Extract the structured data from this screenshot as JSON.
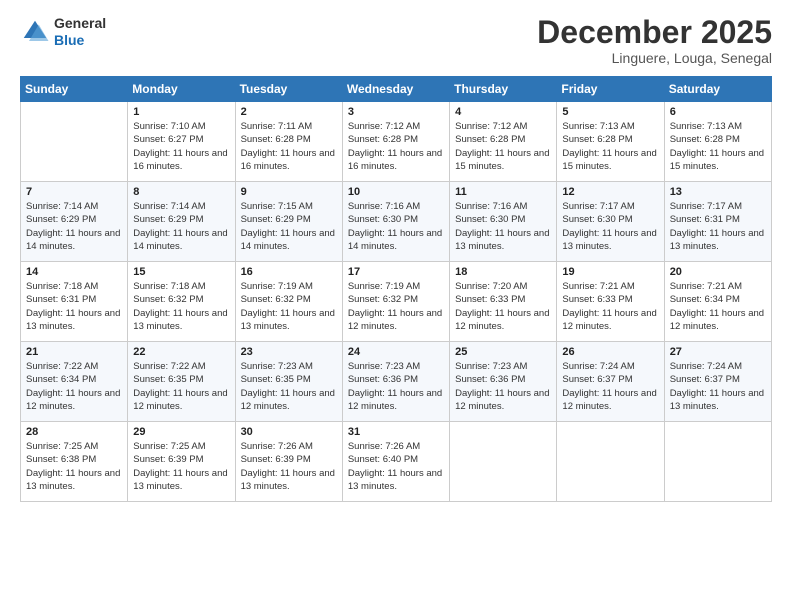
{
  "logo": {
    "general": "General",
    "blue": "Blue"
  },
  "header": {
    "month": "December 2025",
    "location": "Linguere, Louga, Senegal"
  },
  "weekdays": [
    "Sunday",
    "Monday",
    "Tuesday",
    "Wednesday",
    "Thursday",
    "Friday",
    "Saturday"
  ],
  "weeks": [
    [
      {
        "day": "",
        "sunrise": "",
        "sunset": "",
        "daylight": ""
      },
      {
        "day": "1",
        "sunrise": "Sunrise: 7:10 AM",
        "sunset": "Sunset: 6:27 PM",
        "daylight": "Daylight: 11 hours and 16 minutes."
      },
      {
        "day": "2",
        "sunrise": "Sunrise: 7:11 AM",
        "sunset": "Sunset: 6:28 PM",
        "daylight": "Daylight: 11 hours and 16 minutes."
      },
      {
        "day": "3",
        "sunrise": "Sunrise: 7:12 AM",
        "sunset": "Sunset: 6:28 PM",
        "daylight": "Daylight: 11 hours and 16 minutes."
      },
      {
        "day": "4",
        "sunrise": "Sunrise: 7:12 AM",
        "sunset": "Sunset: 6:28 PM",
        "daylight": "Daylight: 11 hours and 15 minutes."
      },
      {
        "day": "5",
        "sunrise": "Sunrise: 7:13 AM",
        "sunset": "Sunset: 6:28 PM",
        "daylight": "Daylight: 11 hours and 15 minutes."
      },
      {
        "day": "6",
        "sunrise": "Sunrise: 7:13 AM",
        "sunset": "Sunset: 6:28 PM",
        "daylight": "Daylight: 11 hours and 15 minutes."
      }
    ],
    [
      {
        "day": "7",
        "sunrise": "Sunrise: 7:14 AM",
        "sunset": "Sunset: 6:29 PM",
        "daylight": "Daylight: 11 hours and 14 minutes."
      },
      {
        "day": "8",
        "sunrise": "Sunrise: 7:14 AM",
        "sunset": "Sunset: 6:29 PM",
        "daylight": "Daylight: 11 hours and 14 minutes."
      },
      {
        "day": "9",
        "sunrise": "Sunrise: 7:15 AM",
        "sunset": "Sunset: 6:29 PM",
        "daylight": "Daylight: 11 hours and 14 minutes."
      },
      {
        "day": "10",
        "sunrise": "Sunrise: 7:16 AM",
        "sunset": "Sunset: 6:30 PM",
        "daylight": "Daylight: 11 hours and 14 minutes."
      },
      {
        "day": "11",
        "sunrise": "Sunrise: 7:16 AM",
        "sunset": "Sunset: 6:30 PM",
        "daylight": "Daylight: 11 hours and 13 minutes."
      },
      {
        "day": "12",
        "sunrise": "Sunrise: 7:17 AM",
        "sunset": "Sunset: 6:30 PM",
        "daylight": "Daylight: 11 hours and 13 minutes."
      },
      {
        "day": "13",
        "sunrise": "Sunrise: 7:17 AM",
        "sunset": "Sunset: 6:31 PM",
        "daylight": "Daylight: 11 hours and 13 minutes."
      }
    ],
    [
      {
        "day": "14",
        "sunrise": "Sunrise: 7:18 AM",
        "sunset": "Sunset: 6:31 PM",
        "daylight": "Daylight: 11 hours and 13 minutes."
      },
      {
        "day": "15",
        "sunrise": "Sunrise: 7:18 AM",
        "sunset": "Sunset: 6:32 PM",
        "daylight": "Daylight: 11 hours and 13 minutes."
      },
      {
        "day": "16",
        "sunrise": "Sunrise: 7:19 AM",
        "sunset": "Sunset: 6:32 PM",
        "daylight": "Daylight: 11 hours and 13 minutes."
      },
      {
        "day": "17",
        "sunrise": "Sunrise: 7:19 AM",
        "sunset": "Sunset: 6:32 PM",
        "daylight": "Daylight: 11 hours and 12 minutes."
      },
      {
        "day": "18",
        "sunrise": "Sunrise: 7:20 AM",
        "sunset": "Sunset: 6:33 PM",
        "daylight": "Daylight: 11 hours and 12 minutes."
      },
      {
        "day": "19",
        "sunrise": "Sunrise: 7:21 AM",
        "sunset": "Sunset: 6:33 PM",
        "daylight": "Daylight: 11 hours and 12 minutes."
      },
      {
        "day": "20",
        "sunrise": "Sunrise: 7:21 AM",
        "sunset": "Sunset: 6:34 PM",
        "daylight": "Daylight: 11 hours and 12 minutes."
      }
    ],
    [
      {
        "day": "21",
        "sunrise": "Sunrise: 7:22 AM",
        "sunset": "Sunset: 6:34 PM",
        "daylight": "Daylight: 11 hours and 12 minutes."
      },
      {
        "day": "22",
        "sunrise": "Sunrise: 7:22 AM",
        "sunset": "Sunset: 6:35 PM",
        "daylight": "Daylight: 11 hours and 12 minutes."
      },
      {
        "day": "23",
        "sunrise": "Sunrise: 7:23 AM",
        "sunset": "Sunset: 6:35 PM",
        "daylight": "Daylight: 11 hours and 12 minutes."
      },
      {
        "day": "24",
        "sunrise": "Sunrise: 7:23 AM",
        "sunset": "Sunset: 6:36 PM",
        "daylight": "Daylight: 11 hours and 12 minutes."
      },
      {
        "day": "25",
        "sunrise": "Sunrise: 7:23 AM",
        "sunset": "Sunset: 6:36 PM",
        "daylight": "Daylight: 11 hours and 12 minutes."
      },
      {
        "day": "26",
        "sunrise": "Sunrise: 7:24 AM",
        "sunset": "Sunset: 6:37 PM",
        "daylight": "Daylight: 11 hours and 12 minutes."
      },
      {
        "day": "27",
        "sunrise": "Sunrise: 7:24 AM",
        "sunset": "Sunset: 6:37 PM",
        "daylight": "Daylight: 11 hours and 13 minutes."
      }
    ],
    [
      {
        "day": "28",
        "sunrise": "Sunrise: 7:25 AM",
        "sunset": "Sunset: 6:38 PM",
        "daylight": "Daylight: 11 hours and 13 minutes."
      },
      {
        "day": "29",
        "sunrise": "Sunrise: 7:25 AM",
        "sunset": "Sunset: 6:39 PM",
        "daylight": "Daylight: 11 hours and 13 minutes."
      },
      {
        "day": "30",
        "sunrise": "Sunrise: 7:26 AM",
        "sunset": "Sunset: 6:39 PM",
        "daylight": "Daylight: 11 hours and 13 minutes."
      },
      {
        "day": "31",
        "sunrise": "Sunrise: 7:26 AM",
        "sunset": "Sunset: 6:40 PM",
        "daylight": "Daylight: 11 hours and 13 minutes."
      },
      {
        "day": "",
        "sunrise": "",
        "sunset": "",
        "daylight": ""
      },
      {
        "day": "",
        "sunrise": "",
        "sunset": "",
        "daylight": ""
      },
      {
        "day": "",
        "sunrise": "",
        "sunset": "",
        "daylight": ""
      }
    ]
  ]
}
